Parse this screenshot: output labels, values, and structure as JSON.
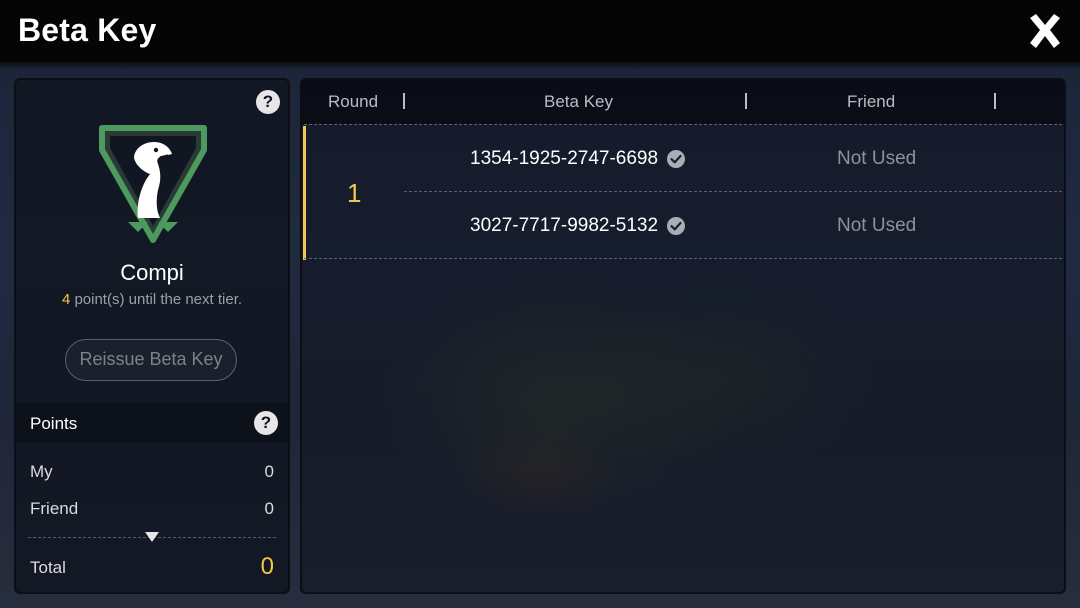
{
  "header": {
    "title": "Beta Key",
    "close_icon": "close-icon"
  },
  "colors": {
    "accent": "#f2c84b",
    "emblem_green": "#4e9a5e",
    "background": "#1e2638"
  },
  "left_panel": {
    "tier_name": "Compi",
    "points_to_next": "4",
    "points_to_next_text": " point(s) until the next tier.",
    "reissue_label": "Reissue Beta Key",
    "points": {
      "title": "Points",
      "rows": [
        {
          "label": "My",
          "value": "0"
        },
        {
          "label": "Friend",
          "value": "0"
        }
      ],
      "total_label": "Total",
      "total_value": "0"
    }
  },
  "table": {
    "columns": [
      "Round",
      "Beta Key",
      "Friend"
    ],
    "rounds": [
      {
        "round": "1",
        "keys": [
          {
            "key": "1354-1925-2747-6698",
            "status": "Not Used"
          },
          {
            "key": "3027-7717-9982-5132",
            "status": "Not Used"
          }
        ]
      }
    ]
  }
}
